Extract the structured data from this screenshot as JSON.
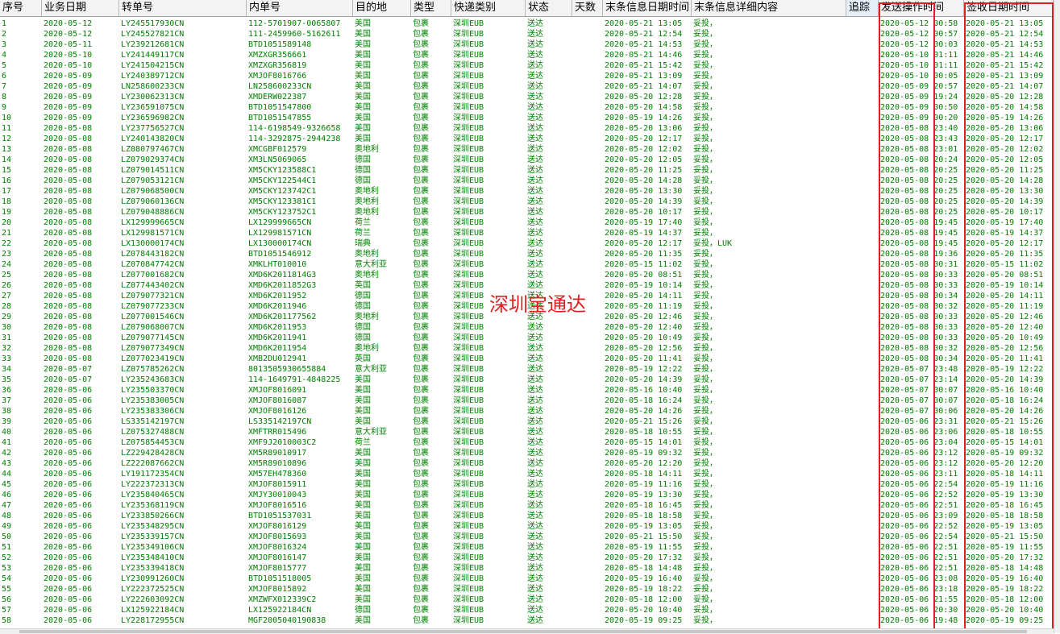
{
  "table": {
    "columns": [
      "序号",
      "业务日期",
      "转单号",
      "内单号",
      "目的地",
      "类型",
      "快递类别",
      "状态",
      "天数",
      "末条信息日期时间",
      "末条信息详细内容",
      "追踪",
      "发送操作时间",
      "签收日期时间"
    ],
    "rows": [
      [
        "1",
        "2020-05-12",
        "LY245517930CN",
        "112-5701907-0065807",
        "美国",
        "包裹",
        "深圳EUB",
        "送达",
        "",
        "2020-05-21 13:05",
        "妥投，",
        "",
        "2020-05-12 00:58",
        "2020-05-21 13:05"
      ],
      [
        "2",
        "2020-05-12",
        "LY245527821CN",
        "111-2459960-5162611",
        "美国",
        "包裹",
        "深圳EUB",
        "送达",
        "",
        "2020-05-21 12:54",
        "妥投，",
        "",
        "2020-05-12 00:57",
        "2020-05-21 12:54"
      ],
      [
        "3",
        "2020-05-11",
        "LY239212681CN",
        "BTD1051589148",
        "美国",
        "包裹",
        "深圳EUB",
        "送达",
        "",
        "2020-05-21 14:53",
        "妥投，",
        "",
        "2020-05-12 00:03",
        "2020-05-21 14:53"
      ],
      [
        "4",
        "2020-05-10",
        "LY241449117CN",
        "XMZXGR356661",
        "美国",
        "包裹",
        "深圳EUB",
        "送达",
        "",
        "2020-05-21 14:46",
        "妥投，",
        "",
        "2020-05-10 01:11",
        "2020-05-21 14:46"
      ],
      [
        "5",
        "2020-05-10",
        "LY241504215CN",
        "XMZXGR356819",
        "美国",
        "包裹",
        "深圳EUB",
        "送达",
        "",
        "2020-05-21 15:42",
        "妥投，",
        "",
        "2020-05-10 01:11",
        "2020-05-21 15:42"
      ],
      [
        "6",
        "2020-05-09",
        "LY240389712CN",
        "XMJOF8016766",
        "美国",
        "包裹",
        "深圳EUB",
        "送达",
        "",
        "2020-05-21 13:09",
        "妥投，",
        "",
        "2020-05-10 00:05",
        "2020-05-21 13:09"
      ],
      [
        "7",
        "2020-05-09",
        "LN258600233CN",
        "LN258600233CN",
        "美国",
        "包裹",
        "深圳EUB",
        "送达",
        "",
        "2020-05-21 14:07",
        "妥投，",
        "",
        "2020-05-09 20:57",
        "2020-05-21 14:07"
      ],
      [
        "8",
        "2020-05-09",
        "LY230062313CN",
        "XMDERW022387",
        "美国",
        "包裹",
        "深圳EUB",
        "送达",
        "",
        "2020-05-20 12:28",
        "妥投，",
        "",
        "2020-05-09 19:24",
        "2020-05-20 12:28"
      ],
      [
        "9",
        "2020-05-09",
        "LY236591075CN",
        "BTD1051547800",
        "美国",
        "包裹",
        "深圳EUB",
        "送达",
        "",
        "2020-05-20 14:58",
        "妥投，",
        "",
        "2020-05-09 00:50",
        "2020-05-20 14:58"
      ],
      [
        "10",
        "2020-05-09",
        "LY236596982CN",
        "BTD1051547855",
        "美国",
        "包裹",
        "深圳EUB",
        "送达",
        "",
        "2020-05-19 14:26",
        "妥投，",
        "",
        "2020-05-09 00:20",
        "2020-05-19 14:26"
      ],
      [
        "11",
        "2020-05-08",
        "LY237756527CN",
        "114-6198549-9326658",
        "美国",
        "包裹",
        "深圳EUB",
        "送达",
        "",
        "2020-05-20 13:06",
        "妥投，",
        "",
        "2020-05-08 23:40",
        "2020-05-20 13:06"
      ],
      [
        "12",
        "2020-05-08",
        "LY240143820CN",
        "114-3292875-2944238",
        "美国",
        "包裹",
        "深圳EUB",
        "送达",
        "",
        "2020-05-20 12:17",
        "妥投，",
        "",
        "2020-05-08 23:43",
        "2020-05-20 12:17"
      ],
      [
        "13",
        "2020-05-08",
        "LZ080797467CN",
        "XMCGBF012579",
        "奥地利",
        "包裹",
        "深圳EUB",
        "送达",
        "",
        "2020-05-20 12:02",
        "妥投，",
        "",
        "2020-05-08 23:01",
        "2020-05-20 12:02"
      ],
      [
        "14",
        "2020-05-08",
        "LZ079029374CN",
        "XM3LN5069065",
        "德国",
        "包裹",
        "深圳EUB",
        "送达",
        "",
        "2020-05-20 12:05",
        "妥投，",
        "",
        "2020-05-08 20:24",
        "2020-05-20 12:05"
      ],
      [
        "15",
        "2020-05-08",
        "LZ079014511CN",
        "XM5CKY123588C1",
        "德国",
        "包裹",
        "深圳EUB",
        "送达",
        "",
        "2020-05-20 11:25",
        "妥投，",
        "",
        "2020-05-08 20:25",
        "2020-05-20 11:25"
      ],
      [
        "16",
        "2020-05-08",
        "LZ079053121CN",
        "XM5CKY122544C1",
        "德国",
        "包裹",
        "深圳EUB",
        "送达",
        "",
        "2020-05-20 14:28",
        "妥投，",
        "",
        "2020-05-08 20:25",
        "2020-05-20 14:28"
      ],
      [
        "17",
        "2020-05-08",
        "LZ079068500CN",
        "XM5CKY123742C1",
        "奥地利",
        "包裹",
        "深圳EUB",
        "送达",
        "",
        "2020-05-20 13:30",
        "妥投，",
        "",
        "2020-05-08 20:25",
        "2020-05-20 13:30"
      ],
      [
        "18",
        "2020-05-08",
        "LZ079060136CN",
        "XM5CKY123381C1",
        "奥地利",
        "包裹",
        "深圳EUB",
        "送达",
        "",
        "2020-05-20 14:39",
        "妥投，",
        "",
        "2020-05-08 20:25",
        "2020-05-20 14:39"
      ],
      [
        "19",
        "2020-05-08",
        "LZ079048886CN",
        "XM5CKY123752C1",
        "奥地利",
        "包裹",
        "深圳EUB",
        "送达",
        "",
        "2020-05-20 10:17",
        "妥投，",
        "",
        "2020-05-08 20:25",
        "2020-05-20 10:17"
      ],
      [
        "20",
        "2020-05-08",
        "LX129999665CN",
        "LX129999665CN",
        "荷兰",
        "包裹",
        "深圳EUB",
        "送达",
        "",
        "2020-05-19 17:40",
        "妥投，",
        "",
        "2020-05-08 19:45",
        "2020-05-19 17:40"
      ],
      [
        "21",
        "2020-05-08",
        "LX129981571CN",
        "LX129981571CN",
        "荷兰",
        "包裹",
        "深圳EUB",
        "送达",
        "",
        "2020-05-19 14:37",
        "妥投，",
        "",
        "2020-05-08 19:45",
        "2020-05-19 14:37"
      ],
      [
        "22",
        "2020-05-08",
        "LX130000174CN",
        "LX130000174CN",
        "瑞典",
        "包裹",
        "深圳EUB",
        "送达",
        "",
        "2020-05-20 12:17",
        "妥投，LUK",
        "",
        "2020-05-08 19:45",
        "2020-05-20 12:17"
      ],
      [
        "23",
        "2020-05-08",
        "LZ078443182CN",
        "BTD1051546912",
        "奥地利",
        "包裹",
        "深圳EUB",
        "送达",
        "",
        "2020-05-20 11:35",
        "妥投，",
        "",
        "2020-05-08 19:36",
        "2020-05-20 11:35"
      ],
      [
        "24",
        "2020-05-08",
        "LZ070847742CN",
        "XMKLHT010010",
        "意大利亚",
        "包裹",
        "深圳EUB",
        "送达",
        "",
        "2020-05-15 11:02",
        "妥投，",
        "",
        "2020-05-08 00:31",
        "2020-05-15 11:02"
      ],
      [
        "25",
        "2020-05-08",
        "LZ077001682CN",
        "XMD6K2011814G3",
        "奥地利",
        "包裹",
        "深圳EUB",
        "送达",
        "",
        "2020-05-20 08:51",
        "妥投，",
        "",
        "2020-05-08 00:33",
        "2020-05-20 08:51"
      ],
      [
        "26",
        "2020-05-08",
        "LZ077443402CN",
        "XMD6K2011852G3",
        "英国",
        "包裹",
        "深圳EUB",
        "送达",
        "",
        "2020-05-19 10:14",
        "妥投，",
        "",
        "2020-05-08 00:33",
        "2020-05-19 10:14"
      ],
      [
        "27",
        "2020-05-08",
        "LZ079077321CN",
        "XMD6K2011952",
        "德国",
        "包裹",
        "深圳EUB",
        "送达",
        "",
        "2020-05-20 14:11",
        "妥投，",
        "",
        "2020-05-08 00:34",
        "2020-05-20 14:11"
      ],
      [
        "28",
        "2020-05-08",
        "LZ079077233CN",
        "XMD6K2011946",
        "德国",
        "包裹",
        "深圳EUB",
        "送达",
        "",
        "2020-05-20 11:19",
        "妥投，",
        "",
        "2020-05-08 00:32",
        "2020-05-20 11:19"
      ],
      [
        "29",
        "2020-05-08",
        "LZ077001546CN",
        "XMD6K201177562",
        "奥地利",
        "包裹",
        "深圳EUB",
        "送达",
        "",
        "2020-05-20 12:46",
        "妥投，",
        "",
        "2020-05-08 00:33",
        "2020-05-20 12:46"
      ],
      [
        "30",
        "2020-05-08",
        "LZ079068007CN",
        "XMD6K2011953",
        "德国",
        "包裹",
        "深圳EUB",
        "送达",
        "",
        "2020-05-20 12:40",
        "妥投，",
        "",
        "2020-05-08 00:33",
        "2020-05-20 12:40"
      ],
      [
        "31",
        "2020-05-08",
        "LZ079077145CN",
        "XMD6K2011941",
        "德国",
        "包裹",
        "深圳EUB",
        "送达",
        "",
        "2020-05-20 10:49",
        "妥投，",
        "",
        "2020-05-08 00:33",
        "2020-05-20 10:49"
      ],
      [
        "32",
        "2020-05-08",
        "LZ079077349CN",
        "XMD6K2011954",
        "奥地利",
        "包裹",
        "深圳EUB",
        "送达",
        "",
        "2020-05-20 12:56",
        "妥投，",
        "",
        "2020-05-08 00:32",
        "2020-05-20 12:56"
      ],
      [
        "33",
        "2020-05-08",
        "LZ077023419CN",
        "XMB2DU012941",
        "英国",
        "包裹",
        "深圳EUB",
        "送达",
        "",
        "2020-05-20 11:41",
        "妥投，",
        "",
        "2020-05-08 00:34",
        "2020-05-20 11:41"
      ],
      [
        "34",
        "2020-05-07",
        "LZ075785262CN",
        "8013505930655884",
        "意大利亚",
        "包裹",
        "深圳EUB",
        "送达",
        "",
        "2020-05-19 12:22",
        "妥投，",
        "",
        "2020-05-07 23:48",
        "2020-05-19 12:22"
      ],
      [
        "35",
        "2020-05-07",
        "LY235243683CN",
        "114-1649791-4848225",
        "美国",
        "包裹",
        "深圳EUB",
        "送达",
        "",
        "2020-05-20 14:39",
        "妥投，",
        "",
        "2020-05-07 23:14",
        "2020-05-20 14:39"
      ],
      [
        "36",
        "2020-05-06",
        "LY235503370CN",
        "XMJOF8016091",
        "美国",
        "包裹",
        "深圳EUB",
        "送达",
        "",
        "2020-05-16 10:40",
        "妥投，",
        "",
        "2020-05-07 00:07",
        "2020-05-16 10:40"
      ],
      [
        "37",
        "2020-05-06",
        "LY235383005CN",
        "XMJOF8016087",
        "美国",
        "包裹",
        "深圳EUB",
        "送达",
        "",
        "2020-05-18 16:24",
        "妥投，",
        "",
        "2020-05-07 00:07",
        "2020-05-18 16:24"
      ],
      [
        "38",
        "2020-05-06",
        "LY235383306CN",
        "XMJOF8016126",
        "美国",
        "包裹",
        "深圳EUB",
        "送达",
        "",
        "2020-05-20 14:26",
        "妥投，",
        "",
        "2020-05-07 00:06",
        "2020-05-20 14:26"
      ],
      [
        "39",
        "2020-05-06",
        "LS335142197CN",
        "LS335142197CN",
        "美国",
        "包裹",
        "深圳EUB",
        "送达",
        "",
        "2020-05-21 15:26",
        "妥投，",
        "",
        "2020-05-06 23:31",
        "2020-05-21 15:26"
      ],
      [
        "40",
        "2020-05-06",
        "LZ075327488CN",
        "XMFTRR015496",
        "意大利亚",
        "包裹",
        "深圳EUB",
        "送达",
        "",
        "2020-05-18 10:55",
        "妥投，",
        "",
        "2020-05-06 23:06",
        "2020-05-18 10:55"
      ],
      [
        "41",
        "2020-05-06",
        "LZ075854453CN",
        "XMF9J2010003C2",
        "荷兰",
        "包裹",
        "深圳EUB",
        "送达",
        "",
        "2020-05-15 14:01",
        "妥投，",
        "",
        "2020-05-06 23:04",
        "2020-05-15 14:01"
      ],
      [
        "42",
        "2020-05-06",
        "LZ229428428CN",
        "XM5R89010917",
        "美国",
        "包裹",
        "深圳EUB",
        "送达",
        "",
        "2020-05-19 09:32",
        "妥投，",
        "",
        "2020-05-06 23:12",
        "2020-05-19 09:32"
      ],
      [
        "43",
        "2020-05-06",
        "LZ222087662CN",
        "XM5R89010896",
        "美国",
        "包裹",
        "深圳EUB",
        "送达",
        "",
        "2020-05-20 12:20",
        "妥投，",
        "",
        "2020-05-06 23:12",
        "2020-05-20 12:20"
      ],
      [
        "44",
        "2020-05-06",
        "LY191172354CN",
        "XM57EH478360",
        "美国",
        "包裹",
        "深圳EUB",
        "送达",
        "",
        "2020-05-18 14:11",
        "妥投，",
        "",
        "2020-05-06 23:11",
        "2020-05-18 14:11"
      ],
      [
        "45",
        "2020-05-06",
        "LY222372313CN",
        "XMJOF8015911",
        "美国",
        "包裹",
        "深圳EUB",
        "送达",
        "",
        "2020-05-19 11:16",
        "妥投，",
        "",
        "2020-05-06 22:54",
        "2020-05-19 11:16"
      ],
      [
        "46",
        "2020-05-06",
        "LY235840465CN",
        "XMJY30010043",
        "美国",
        "包裹",
        "深圳EUB",
        "送达",
        "",
        "2020-05-19 13:30",
        "妥投，",
        "",
        "2020-05-06 22:52",
        "2020-05-19 13:30"
      ],
      [
        "47",
        "2020-05-06",
        "LY235368119CN",
        "XMJOF8016516",
        "美国",
        "包裹",
        "深圳EUB",
        "送达",
        "",
        "2020-05-18 16:45",
        "妥投，",
        "",
        "2020-05-06 22:51",
        "2020-05-18 16:45"
      ],
      [
        "48",
        "2020-05-06",
        "LY233850266CN",
        "BTD1051537031",
        "美国",
        "包裹",
        "深圳EUB",
        "送达",
        "",
        "2020-05-18 18:58",
        "妥投，",
        "",
        "2020-05-06 23:09",
        "2020-05-18 18:58"
      ],
      [
        "49",
        "2020-05-06",
        "LY235348295CN",
        "XMJOF8016129",
        "美国",
        "包裹",
        "深圳EUB",
        "送达",
        "",
        "2020-05-19 13:05",
        "妥投，",
        "",
        "2020-05-06 22:52",
        "2020-05-19 13:05"
      ],
      [
        "50",
        "2020-05-06",
        "LY235339157CN",
        "XMJOF8015693",
        "美国",
        "包裹",
        "深圳EUB",
        "送达",
        "",
        "2020-05-21 15:50",
        "妥投，",
        "",
        "2020-05-06 22:54",
        "2020-05-21 15:50"
      ],
      [
        "51",
        "2020-05-06",
        "LY235349106CN",
        "XMJOF8016324",
        "美国",
        "包裹",
        "深圳EUB",
        "送达",
        "",
        "2020-05-19 11:55",
        "妥投，",
        "",
        "2020-05-06 22:51",
        "2020-05-19 11:55"
      ],
      [
        "52",
        "2020-05-06",
        "LY235348410CN",
        "XMJOF8016147",
        "美国",
        "包裹",
        "深圳EUB",
        "送达",
        "",
        "2020-05-20 17:32",
        "妥投，",
        "",
        "2020-05-06 22:51",
        "2020-05-20 17:32"
      ],
      [
        "53",
        "2020-05-06",
        "LY235339418CN",
        "XMJOF8015777",
        "美国",
        "包裹",
        "深圳EUB",
        "送达",
        "",
        "2020-05-18 14:48",
        "妥投，",
        "",
        "2020-05-06 22:51",
        "2020-05-18 14:48"
      ],
      [
        "54",
        "2020-05-06",
        "LY230991260CN",
        "BTD1051518005",
        "美国",
        "包裹",
        "深圳EUB",
        "送达",
        "",
        "2020-05-19 16:40",
        "妥投，",
        "",
        "2020-05-06 23:08",
        "2020-05-19 16:40"
      ],
      [
        "55",
        "2020-05-06",
        "LY222372525CN",
        "XMJOF8015892",
        "美国",
        "包裹",
        "深圳EUB",
        "送达",
        "",
        "2020-05-19 18:22",
        "妥投，",
        "",
        "2020-05-06 23:18",
        "2020-05-19 18:22"
      ],
      [
        "56",
        "2020-05-06",
        "LY222603092CN",
        "XMZWFX012339C2",
        "美国",
        "包裹",
        "深圳EUB",
        "送达",
        "",
        "2020-05-18 12:00",
        "妥投，",
        "",
        "2020-05-06 21:55",
        "2020-05-18 12:00"
      ],
      [
        "57",
        "2020-05-06",
        "LX125922184CN",
        "LX125922184CN",
        "德国",
        "包裹",
        "深圳EUB",
        "送达",
        "",
        "2020-05-20 10:40",
        "妥投，",
        "",
        "2020-05-06 20:30",
        "2020-05-20 10:40"
      ],
      [
        "58",
        "2020-05-06",
        "LY228172955CN",
        "MGF2005040190838",
        "美国",
        "包裹",
        "深圳EUB",
        "送达",
        "",
        "2020-05-19 09:25",
        "妥投，",
        "",
        "2020-05-06 19:48",
        "2020-05-19 09:25"
      ]
    ]
  },
  "watermark": "深圳宝通达",
  "colors": {
    "text": "#008000",
    "header_bg": "#f3f3f3",
    "highlight": "#e02020"
  }
}
